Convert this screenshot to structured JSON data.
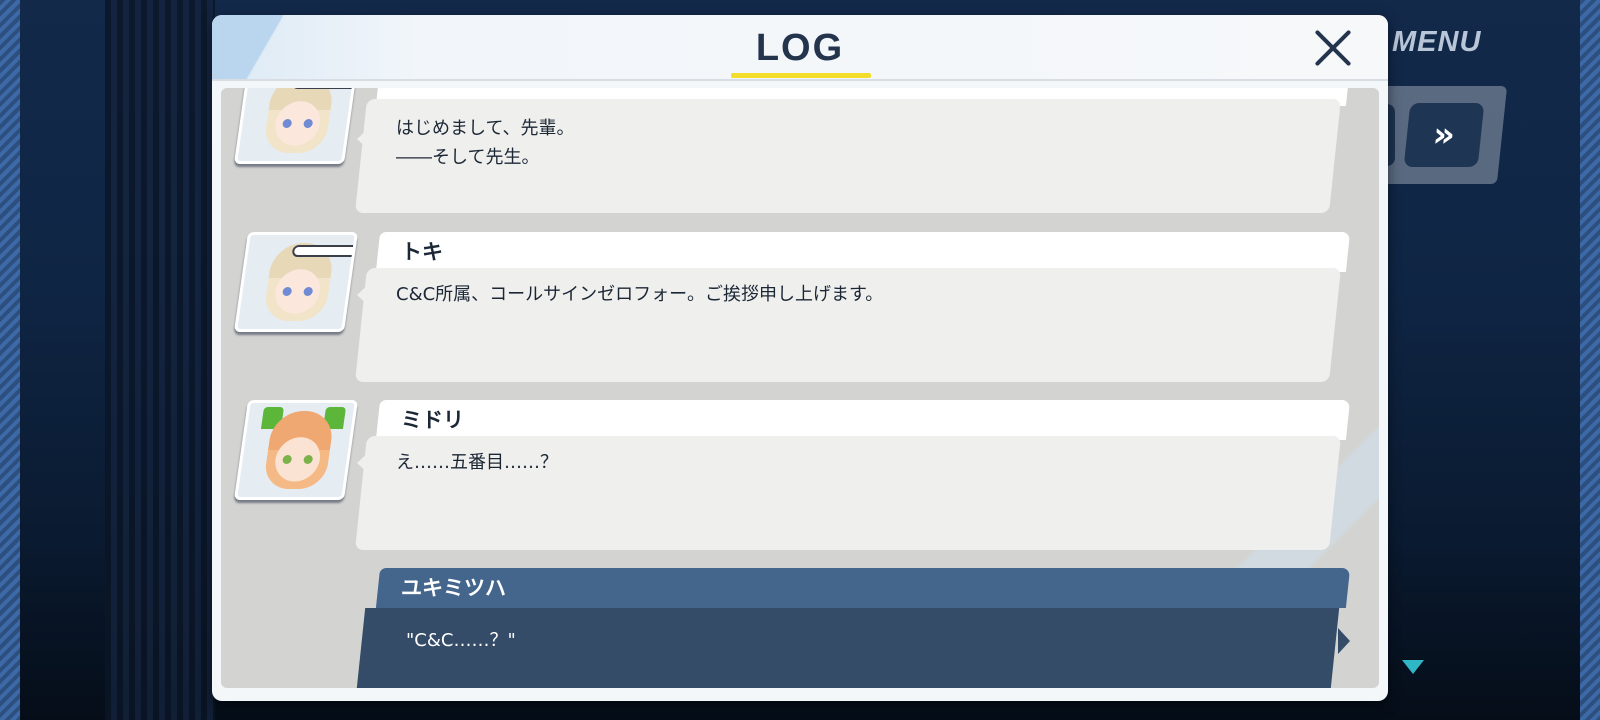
{
  "background": {
    "menu_label": "MENU",
    "fast_forward_icon": "»"
  },
  "log": {
    "title": "LOG",
    "entries": [
      {
        "speaker": "",
        "avatar": "toki-portrait",
        "text": "はじめまして、先輩。\n――そして先生。"
      },
      {
        "speaker": "トキ",
        "avatar": "toki-portrait",
        "text": "C&C所属、コールサインゼロフォー。ご挨拶申し上げます。"
      },
      {
        "speaker": "ミドリ",
        "avatar": "midori-portrait",
        "text": "え……五番目……？"
      },
      {
        "speaker": "ユキミツハ",
        "avatar": "",
        "text": "\"C&C……？\""
      }
    ]
  },
  "colors": {
    "title_underline": "#f2dd2a",
    "player_name_bar": "#44668c",
    "player_message": "#354c69",
    "scroll_arrow": "#2fb7c6"
  }
}
